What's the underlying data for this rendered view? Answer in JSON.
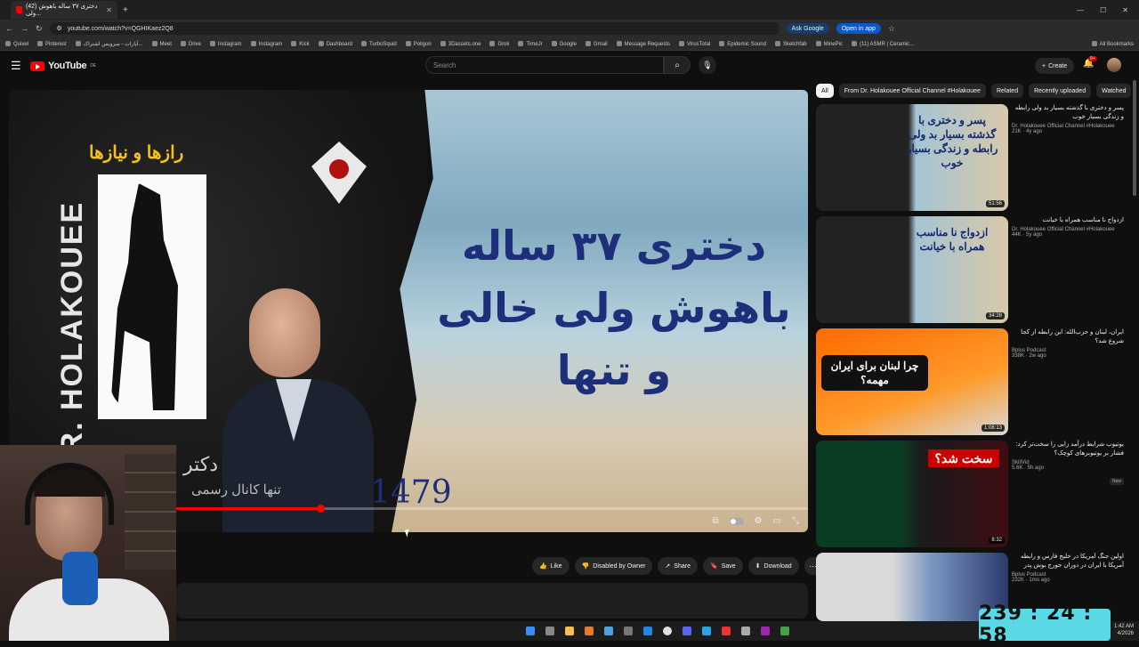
{
  "browser": {
    "tab_title": "(42) دختری ۳۷ ساله باهوش ولی...",
    "new_tab": "+",
    "url": "youtube.com/watch?v=QGHIKaez2Q8",
    "ask_google": "Ask Google",
    "open_in_app": "Open in app",
    "bookmarks": [
      "Quixel",
      "Pinterest",
      "آپارات - سرویس اشتراک...",
      "Meet",
      "Drive",
      "Instagram",
      "Instagram",
      "Kick",
      "Dashboard",
      "TurboSquid",
      "Poligon",
      "3Dassets.one",
      "Grok",
      "TimeJr",
      "Google",
      "Gmail",
      "Message Requests",
      "VirusTotal",
      "Epidemic Sound",
      "Sketchfab",
      "MinePic",
      "(11) ASMR | Ceramic..."
    ],
    "all_bookmarks": "All Bookmarks"
  },
  "youtube": {
    "logo_text": "YouTube",
    "region": "DE",
    "search_placeholder": "Search",
    "create_label": "Create",
    "notif_count": "9+"
  },
  "video": {
    "secret_text": "رازها و نیازها",
    "vertical_text": "DR. HOLAKOUEE",
    "title_line1": "دختری ۳۷ ساله",
    "title_line2": "باهوش ولی خالی",
    "title_line3": "و تنها",
    "episode": "1479",
    "watermark_line1": "دکتر",
    "watermark_line2": "تنها کانال رسمی",
    "progress": 0.39
  },
  "actions": {
    "like": "Like",
    "disabled": "Disabled by Owner",
    "share": "Share",
    "save": "Save",
    "download": "Download"
  },
  "filters": [
    "All",
    "From Dr. Holakouee Official Channel #Holakouee",
    "Related",
    "Recently uploaded",
    "Watched"
  ],
  "recommendations": [
    {
      "title": "پسر و دختری با گذشته بسیار بد ولی رابطه و زندگی بسیار خوب",
      "thumb_text": "پسر و دختری با گذشته بسیار بد ولی رابطه و زندگی بسیار خوب",
      "channel": "Dr. Holakouee Official Channel #Holakouee",
      "views": "21K · 4y ago",
      "duration": "51:56"
    },
    {
      "title": "ازدواج نا مناسب همراه با خیانت",
      "thumb_text": "ازدواج نا مناسب همراه با خیانت",
      "channel": "Dr. Holakouee Official Channel #Holakouee",
      "views": "44K · 5y ago",
      "duration": "34:28"
    },
    {
      "title": "ایران، لبنان و حزب‌الله: این رابطه از کجا شروع شد؟",
      "thumb_text": "چرا لبنان برای ایران مهمه؟",
      "channel": "Bplus Podcast",
      "views": "338K · 2w ago",
      "duration": "1:08:13"
    },
    {
      "title": "یوتیوب شرایط درآمد زایی را سخت‌تر کرد: فشار بر یوتیوبرهای کوچک؟",
      "thumb_text": "سخت شد؟",
      "channel": "SkillVid",
      "views": "5.6K · 5h ago",
      "badge": "New",
      "duration": "8:32"
    },
    {
      "title": "اولین جنگ آمریکا در خلیج فارس و رابطه آمریکا با ایران در دوران جورج بوش پدر",
      "thumb_text": "",
      "channel": "Bplus Podcast",
      "views": "232K · 1mo ago",
      "duration": ""
    }
  ],
  "system": {
    "timer": "239 : 24 : 58",
    "clock_time": "1:42 AM",
    "clock_date": "4/2026"
  }
}
